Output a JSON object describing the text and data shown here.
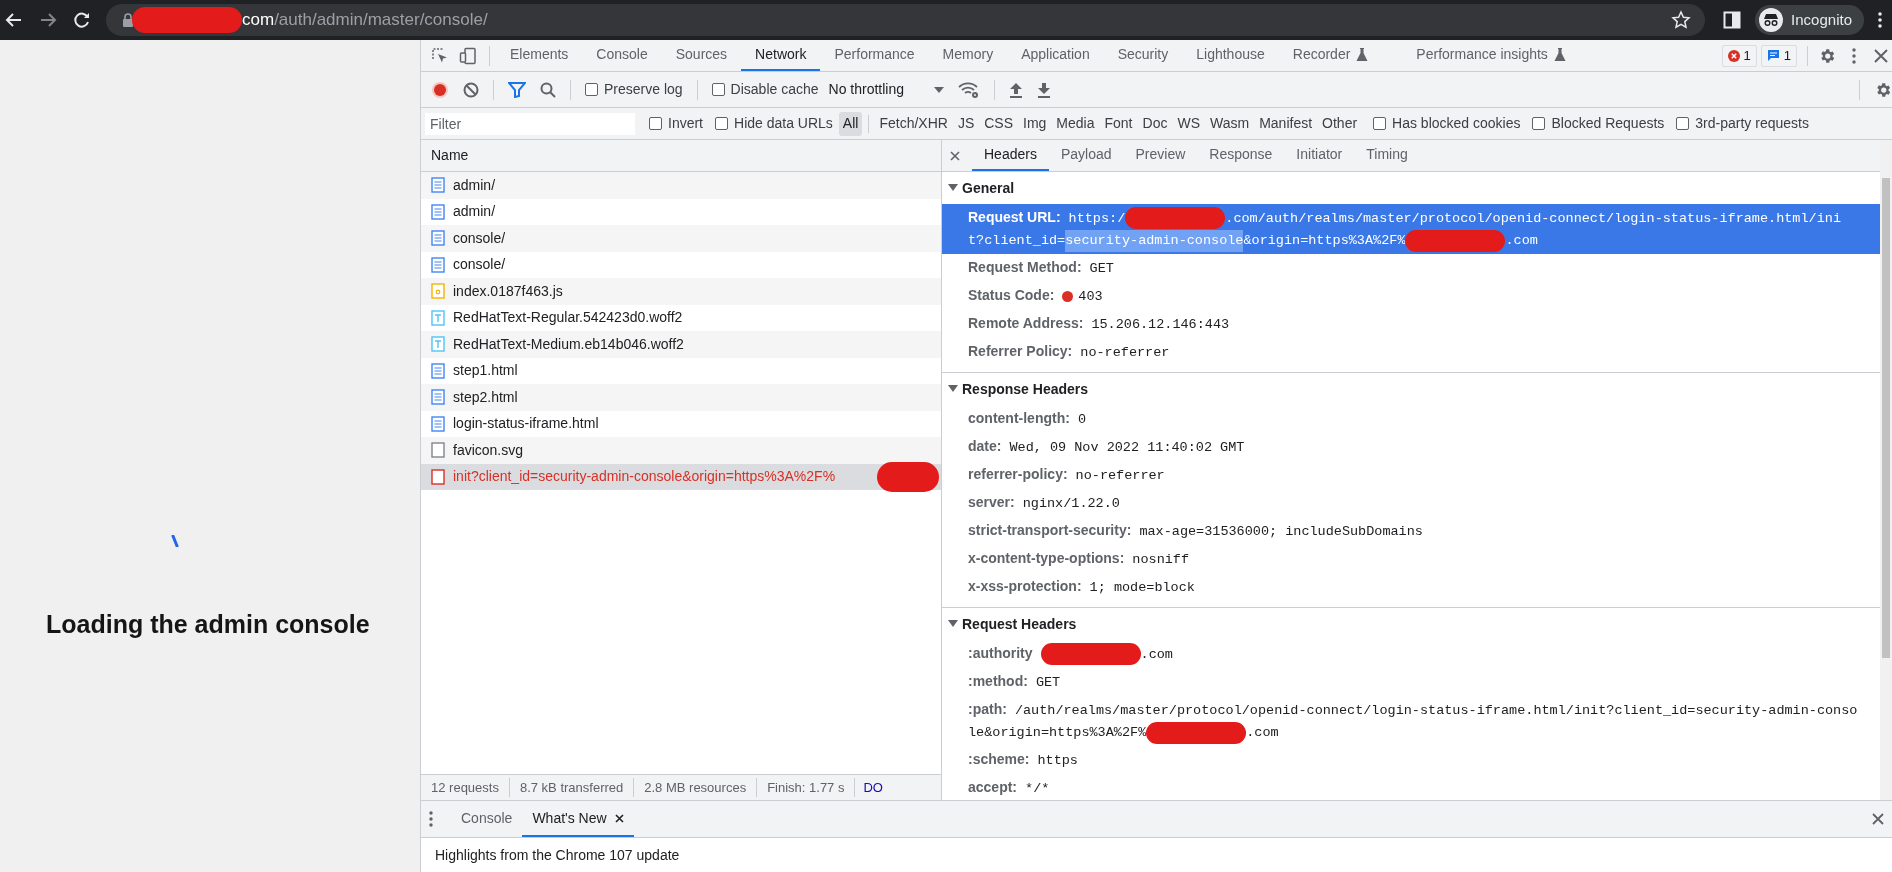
{
  "browser": {
    "address": [
      {
        "kind": "redacted"
      },
      {
        "kind": "host",
        "text": "com"
      },
      {
        "kind": "path",
        "text": "/auth/admin/master/console/"
      }
    ],
    "profile": "Incognito"
  },
  "page": {
    "message": "Loading the admin console"
  },
  "devtools": {
    "tabs": [
      {
        "label": "Elements",
        "selected": false,
        "experimental": false
      },
      {
        "label": "Console",
        "selected": false,
        "experimental": false
      },
      {
        "label": "Sources",
        "selected": false,
        "experimental": false
      },
      {
        "label": "Network",
        "selected": true,
        "experimental": false
      },
      {
        "label": "Performance",
        "selected": false,
        "experimental": false
      },
      {
        "label": "Memory",
        "selected": false,
        "experimental": false
      },
      {
        "label": "Application",
        "selected": false,
        "experimental": false
      },
      {
        "label": "Security",
        "selected": false,
        "experimental": false
      },
      {
        "label": "Lighthouse",
        "selected": false,
        "experimental": false
      },
      {
        "label": "Recorder",
        "selected": false,
        "experimental": true
      },
      {
        "label": "Performance insights",
        "selected": false,
        "experimental": true
      }
    ],
    "error_count": "1",
    "message_count": "1",
    "toolbar": {
      "recording": true,
      "preserve_log": {
        "label": "Preserve log",
        "checked": false
      },
      "disable_cache": {
        "label": "Disable cache",
        "checked": false
      },
      "throttling": "No throttling"
    },
    "filter": {
      "placeholder": "Filter",
      "checkboxes": [
        {
          "label": "Invert",
          "checked": false
        },
        {
          "label": "Hide data URLs",
          "checked": false
        }
      ],
      "types": [
        {
          "label": "All",
          "selected": true
        },
        {
          "label": "Fetch/XHR",
          "selected": false
        },
        {
          "label": "JS",
          "selected": false
        },
        {
          "label": "CSS",
          "selected": false
        },
        {
          "label": "Img",
          "selected": false
        },
        {
          "label": "Media",
          "selected": false
        },
        {
          "label": "Font",
          "selected": false
        },
        {
          "label": "Doc",
          "selected": false
        },
        {
          "label": "WS",
          "selected": false
        },
        {
          "label": "Wasm",
          "selected": false
        },
        {
          "label": "Manifest",
          "selected": false
        },
        {
          "label": "Other",
          "selected": false
        }
      ],
      "more_checkboxes": [
        {
          "label": "Has blocked cookies",
          "checked": false
        },
        {
          "label": "Blocked Requests",
          "checked": false
        },
        {
          "label": "3rd-party requests",
          "checked": false
        }
      ]
    },
    "requests": {
      "column": "Name",
      "rows": [
        {
          "name": "admin/",
          "kind": "document",
          "selected": false,
          "redacted": false
        },
        {
          "name": "admin/",
          "kind": "document",
          "selected": false,
          "redacted": false
        },
        {
          "name": "console/",
          "kind": "document",
          "selected": false,
          "redacted": false
        },
        {
          "name": "console/",
          "kind": "document",
          "selected": false,
          "redacted": false
        },
        {
          "name": "index.0187f463.js",
          "kind": "script",
          "selected": false,
          "redacted": false
        },
        {
          "name": "RedHatText-Regular.542423d0.woff2",
          "kind": "font",
          "selected": false,
          "redacted": false
        },
        {
          "name": "RedHatText-Medium.eb14b046.woff2",
          "kind": "font",
          "selected": false,
          "redacted": false
        },
        {
          "name": "step1.html",
          "kind": "document",
          "selected": false,
          "redacted": false
        },
        {
          "name": "step2.html",
          "kind": "document",
          "selected": false,
          "redacted": false
        },
        {
          "name": "login-status-iframe.html",
          "kind": "document",
          "selected": false,
          "redacted": false
        },
        {
          "name": "favicon.svg",
          "kind": "other",
          "selected": false,
          "redacted": false
        },
        {
          "name": "init?client_id=security-admin-console&origin=https%3A%2F%",
          "kind": "failed",
          "selected": true,
          "redacted": true
        }
      ]
    },
    "summary": [
      "12 requests",
      "8.7 kB transferred",
      "2.8 MB resources",
      "Finish: 1.77 s"
    ],
    "summary_link": "DO",
    "detail_tabs": [
      {
        "label": "Headers",
        "selected": true
      },
      {
        "label": "Payload",
        "selected": false
      },
      {
        "label": "Preview",
        "selected": false
      },
      {
        "label": "Response",
        "selected": false
      },
      {
        "label": "Initiator",
        "selected": false
      },
      {
        "label": "Timing",
        "selected": false
      }
    ],
    "sections": [
      {
        "title": "General",
        "expanded": true,
        "rows": [
          {
            "name": "Request URL:",
            "highlighted": true,
            "lines": [
              [
                {
                  "kind": "text",
                  "text": "https:/"
                },
                {
                  "kind": "redacted"
                },
                {
                  "kind": "text",
                  "text": ".com/auth/realms/master/protocol/openid-connect/login-status-iframe.html/ini"
                }
              ],
              [
                {
                  "kind": "text",
                  "text": "t?client_id="
                },
                {
                  "kind": "selected",
                  "text": "security-admin-console"
                },
                {
                  "kind": "text",
                  "text": "&origin=https%3A%2F%"
                },
                {
                  "kind": "redacted"
                },
                {
                  "kind": "text",
                  "text": ".com"
                }
              ]
            ]
          },
          {
            "name": "Request Method:",
            "highlighted": false,
            "value": "GET"
          },
          {
            "name": "Status Code:",
            "highlighted": false,
            "value": "403",
            "kind": "status"
          },
          {
            "name": "Remote Address:",
            "highlighted": false,
            "value": "15.206.12.146:443"
          },
          {
            "name": "Referrer Policy:",
            "highlighted": false,
            "value": "no-referrer"
          }
        ]
      },
      {
        "title": "Response Headers",
        "expanded": true,
        "rows": [
          {
            "name": "content-length:",
            "highlighted": false,
            "value": "0"
          },
          {
            "name": "date:",
            "highlighted": false,
            "value": "Wed, 09 Nov 2022 11:40:02 GMT"
          },
          {
            "name": "referrer-policy:",
            "highlighted": false,
            "value": "no-referrer"
          },
          {
            "name": "server:",
            "highlighted": false,
            "value": "nginx/1.22.0"
          },
          {
            "name": "strict-transport-security:",
            "highlighted": false,
            "value": "max-age=31536000; includeSubDomains"
          },
          {
            "name": "x-content-type-options:",
            "highlighted": false,
            "value": "nosniff"
          },
          {
            "name": "x-xss-protection:",
            "highlighted": false,
            "value": "1; mode=block"
          }
        ]
      },
      {
        "title": "Request Headers",
        "expanded": true,
        "rows": [
          {
            "name": ":authority",
            "highlighted": false,
            "lines": [
              [
                {
                  "kind": "redacted"
                },
                {
                  "kind": "text",
                  "text": ".com"
                }
              ]
            ]
          },
          {
            "name": ":method:",
            "highlighted": false,
            "value": "GET"
          },
          {
            "name": ":path:",
            "highlighted": false,
            "lines": [
              [
                {
                  "kind": "text",
                  "text": "/auth/realms/master/protocol/openid-connect/login-status-iframe.html/init?client_id=security-admin-conso"
                }
              ],
              [
                {
                  "kind": "text",
                  "text": "le&origin=https%3A%2F%"
                },
                {
                  "kind": "redacted"
                },
                {
                  "kind": "text",
                  "text": ".com"
                }
              ]
            ]
          },
          {
            "name": ":scheme:",
            "highlighted": false,
            "value": "https"
          },
          {
            "name": "accept:",
            "highlighted": false,
            "value": "*/*"
          }
        ]
      }
    ],
    "drawer": {
      "tabs": [
        {
          "label": "Console",
          "selected": false,
          "closable": false
        },
        {
          "label": "What's New",
          "selected": true,
          "closable": true
        }
      ],
      "content": "Highlights from the Chrome 107 update"
    }
  }
}
